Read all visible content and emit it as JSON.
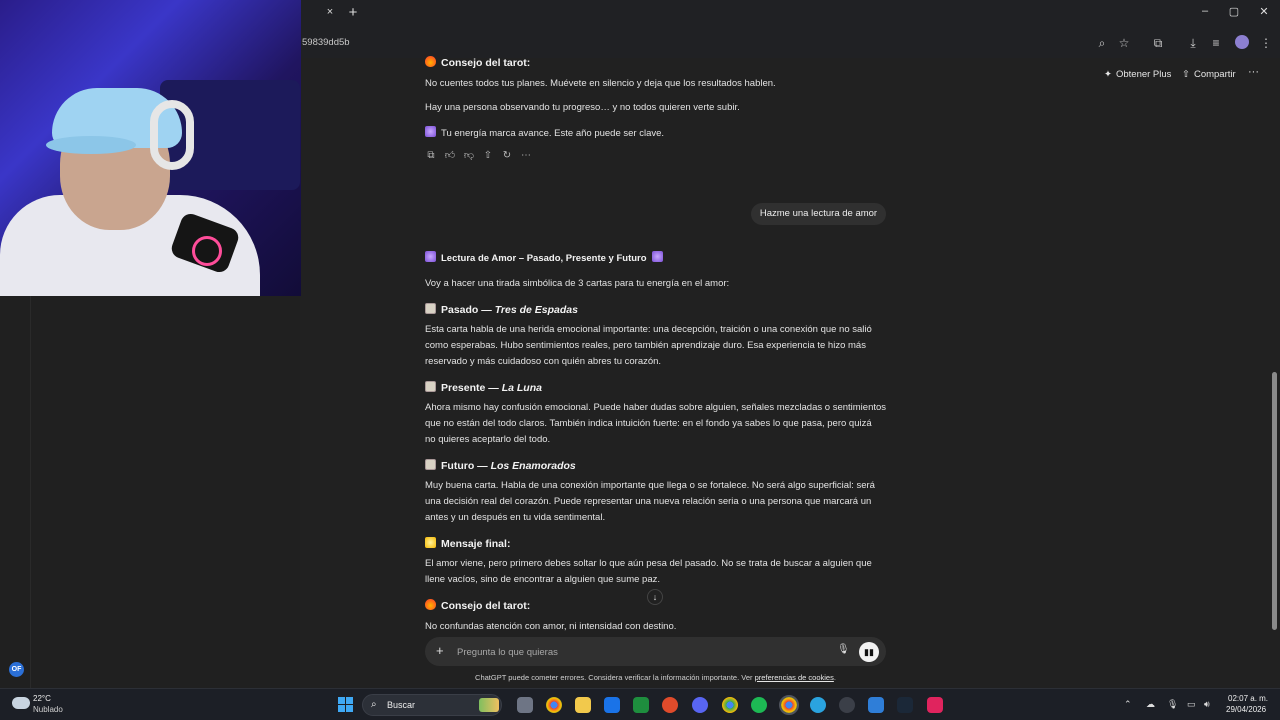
{
  "browser": {
    "url": "59839dd5b",
    "tab_close": "×",
    "new_tab": "+",
    "window_controls": {
      "minimize": "–",
      "maximize": "▢",
      "close": "✕"
    }
  },
  "header": {
    "plus_label": "Obtener Plus",
    "share_label": "Compartir",
    "more": "···"
  },
  "chat": {
    "previous_answer": {
      "heading": "Consejo del tarot:",
      "line1": "No cuentes todos tus planes. Muévete en silencio y deja que los resultados hablen.",
      "line2": "Hay una persona observando tu progreso… y no todos quieren verte subir.",
      "line3": "Tu energía marca avance. Este año puede ser clave."
    },
    "user_message": "Hazme una lectura de amor",
    "answer": {
      "title": "Lectura de Amor – Pasado, Presente y Futuro",
      "intro": "Voy a hacer una tirada simbólica de 3 cartas para tu energía en el amor:",
      "past_label": "Pasado —",
      "past_card": "Tres de Espadas",
      "past_l1": "Esta carta habla de una herida emocional importante: una decepción, traición o una conexión que no salió",
      "past_l2": "como esperabas. Hubo sentimientos reales, pero también aprendizaje duro. Esa experiencia te hizo más",
      "past_l3": "reservado y más cuidadoso con quién abres tu corazón.",
      "present_label": "Presente —",
      "present_card": "La Luna",
      "present_l1": "Ahora mismo hay confusión emocional. Puede haber dudas sobre alguien, señales mezcladas o sentimientos",
      "present_l2": "que no están del todo claros. También indica intuición fuerte: en el fondo ya sabes lo que pasa, pero quizá",
      "present_l3": "no quieres aceptarlo del todo.",
      "future_label": "Futuro —",
      "future_card": "Los Enamorados",
      "future_l1": "Muy buena carta. Habla de una conexión importante que llega o se fortalece. No será algo superficial: será",
      "future_l2": "una decisión real del corazón. Puede representar una nueva relación seria o una persona que marcará un",
      "future_l3": "antes y un después en tu vida sentimental.",
      "final_heading": "Mensaje final:",
      "final_l1": "El amor viene, pero primero debes soltar lo que aún pesa del pasado. No se trata de buscar a alguien que",
      "final_l2": "llene vacíos, sino de encontrar a alguien que sume paz.",
      "tarot_heading": "Consejo del tarot:",
      "tarot_l1": "No confundas atención con amor, ni intensidad con destino."
    },
    "action_icons": [
      "copy-icon",
      "thumbs-up-icon",
      "thumbs-down-icon",
      "share-icon",
      "regenerate-icon",
      "more-icon"
    ]
  },
  "composer": {
    "placeholder": "Pregunta lo que quieras",
    "disclaimer": "ChatGPT puede cometer errores. Considera verificar la información importante. Ver",
    "disclaimer_link": "preferencias de cookies",
    "disclaimer_end": "."
  },
  "overlay_badge": "OF",
  "taskbar": {
    "temp": "22°C",
    "weather": "Nublado",
    "search_label": "Buscar",
    "time": "02:07 a. m.",
    "date": "29/04/2026"
  }
}
